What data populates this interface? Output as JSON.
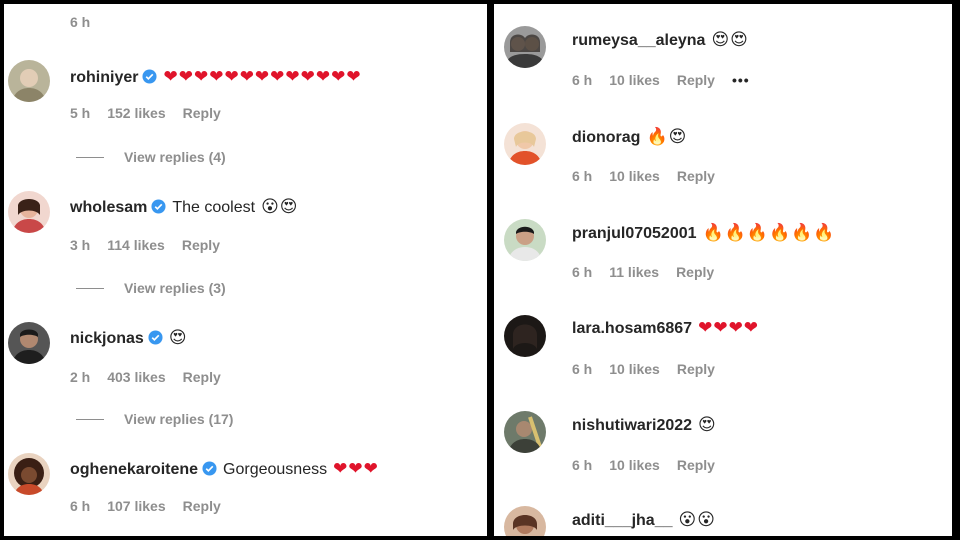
{
  "left": {
    "top_time": "6 h",
    "comments": [
      {
        "username": "rohiniyer",
        "verified": true,
        "text": "",
        "emojis": "❤❤❤❤❤❤❤❤❤❤❤❤❤",
        "time": "5 h",
        "likes": "152 likes",
        "reply": "Reply",
        "view_replies": "View replies (4)",
        "avatar_color": "#b9b49a"
      },
      {
        "username": "wholesam",
        "verified": true,
        "text": "The coolest",
        "emojis": "😮😍",
        "time": "3 h",
        "likes": "114 likes",
        "reply": "Reply",
        "view_replies": "View replies (3)",
        "avatar_color": "#d46a6a"
      },
      {
        "username": "nickjonas",
        "verified": true,
        "text": "",
        "emojis": "😍",
        "time": "2 h",
        "likes": "403 likes",
        "reply": "Reply",
        "view_replies": "View replies (17)",
        "avatar_color": "#3a3a3a"
      },
      {
        "username": "oghenekaroitene",
        "verified": true,
        "text": "Gorgeousness",
        "emojis": "❤❤❤",
        "time": "6 h",
        "likes": "107 likes",
        "reply": "Reply",
        "view_replies": "",
        "avatar_color": "#6b3a28"
      }
    ]
  },
  "right": {
    "comments": [
      {
        "username": "rumeysa__aleyna",
        "text": "",
        "emojis": "😍😍",
        "time": "6 h",
        "likes": "10 likes",
        "reply": "Reply",
        "more": "•••",
        "avatar_color": "#8a8a8a"
      },
      {
        "username": "dionorag",
        "text": "",
        "emojis": "🔥😍",
        "time": "6 h",
        "likes": "10 likes",
        "reply": "Reply",
        "more": "",
        "avatar_color": "#e39a7a"
      },
      {
        "username": "pranjul07052001",
        "text": "",
        "emojis": "🔥🔥🔥🔥🔥🔥",
        "time": "6 h",
        "likes": "11 likes",
        "reply": "Reply",
        "more": "",
        "avatar_color": "#c8d8c0"
      },
      {
        "username": "lara.hosam6867",
        "text": "",
        "emojis": "❤❤❤❤",
        "time": "6 h",
        "likes": "10 likes",
        "reply": "Reply",
        "more": "",
        "avatar_color": "#2a2420"
      },
      {
        "username": "nishutiwari2022",
        "text": "",
        "emojis": "😍",
        "time": "6 h",
        "likes": "10 likes",
        "reply": "Reply",
        "more": "",
        "avatar_color": "#5c6a5a"
      },
      {
        "username": "aditi___jha__",
        "text": "",
        "emojis": "😮😮",
        "time": "",
        "likes": "",
        "reply": "",
        "more": "",
        "avatar_color": "#9b6b5a"
      }
    ]
  },
  "colors": {
    "verified": "#3897f0",
    "heart": "#e0142b",
    "meta": "#8e8e8e"
  }
}
